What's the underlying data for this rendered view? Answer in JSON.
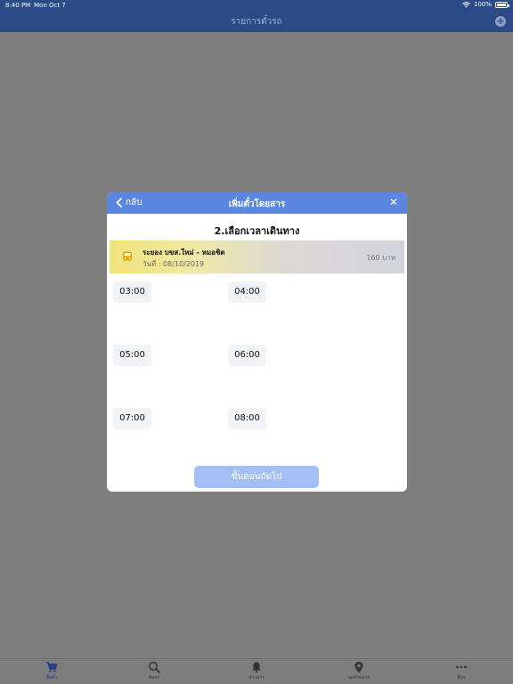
{
  "status": {
    "time": "8:40 PM",
    "date": "Mon Oct 7",
    "battery": "100%"
  },
  "navbar": {
    "title": "รายการตั๋วรถ"
  },
  "modal": {
    "back_label": "กลับ",
    "title": "เพิ่มตั๋วโดยสาร",
    "step_title": "2.เลือกเวลาเดินทาง",
    "route": {
      "name": "ระยอง บขส.ใหม่ - หมอชิต",
      "date": "วันที่ : 08/10/2019",
      "price": "160 บาท"
    },
    "times": [
      "03:00",
      "04:00",
      "05:00",
      "06:00",
      "07:00",
      "08:00"
    ],
    "next_label": "ขั้นตอนถัดไป"
  },
  "tabbar": {
    "items": [
      {
        "label": "ซื้อตั๋ว",
        "icon": "cart-icon",
        "active": true
      },
      {
        "label": "ค้นหา",
        "icon": "search-icon",
        "active": false
      },
      {
        "label": "ข่าวสาร",
        "icon": "bell-icon",
        "active": false
      },
      {
        "label": "จุดจำหน่าย",
        "icon": "location-pin-icon",
        "active": false
      },
      {
        "label": "อื่นๆ",
        "icon": "more-icon",
        "active": false
      }
    ]
  },
  "colors": {
    "navbar": "#2b4a86",
    "modal_header": "#5c87e0",
    "next_button": "#a3bff3",
    "overlay": "#7f7f7f"
  }
}
